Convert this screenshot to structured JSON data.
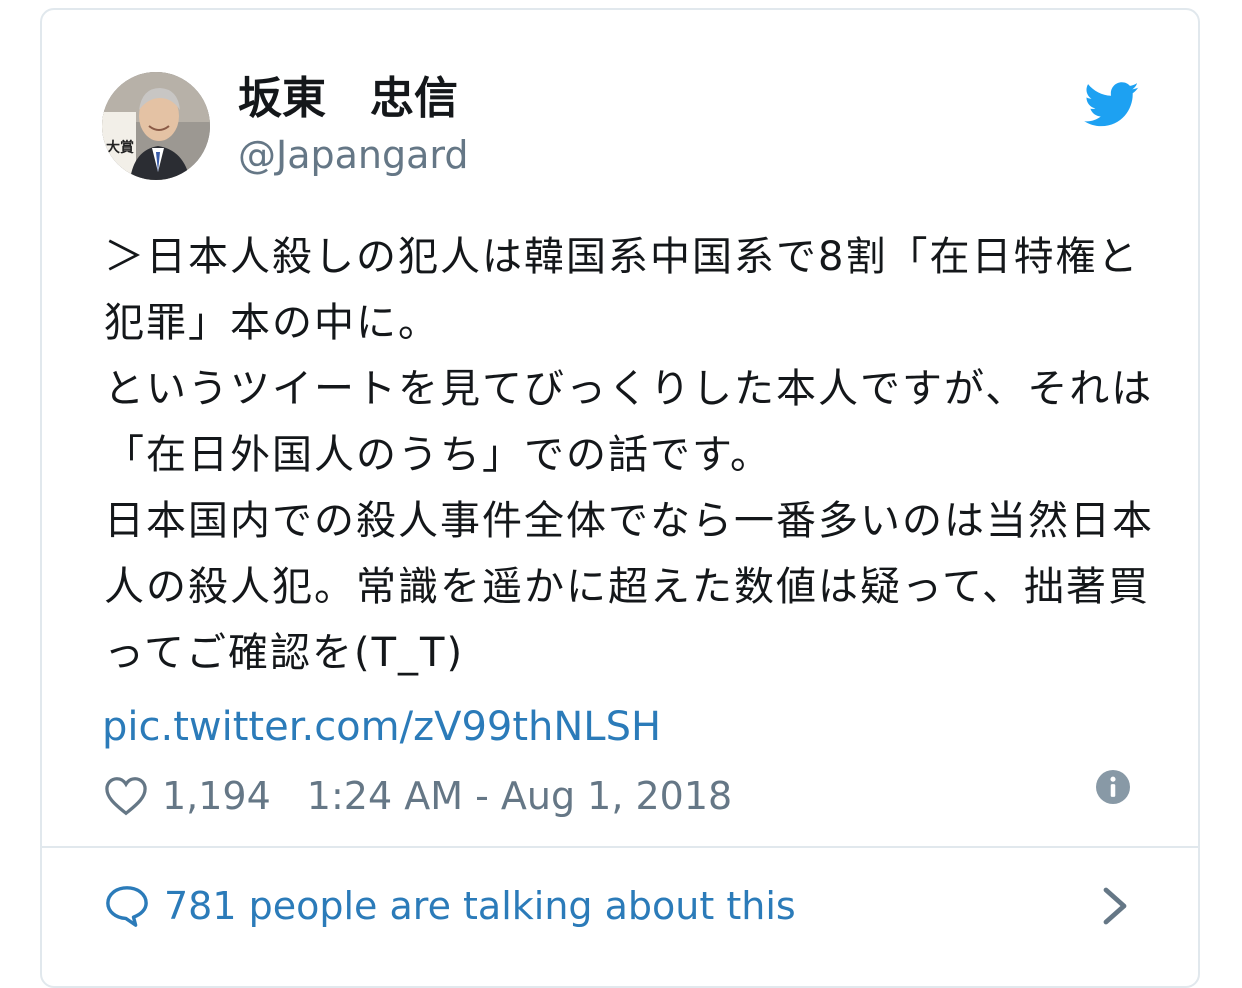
{
  "tweet": {
    "display_name": "坂東　忠信",
    "handle": "@Japangard",
    "text": "＞日本人殺しの犯人は韓国系中国系で8割「在日特権と犯罪」本の中に。\nというツイートを見てびっくりした本人ですが、それは「在日外国人のうち」での話です。\n日本国内での殺人事件全体でなら一番多いのは当然日本人の殺人犯。常識を遥かに超えた数値は疑って、拙著買ってご確認を(T_T)",
    "pic_link": "pic.twitter.com/zV99thNLSH",
    "like_count": "1,194",
    "timestamp": "1:24 AM - Aug 1, 2018",
    "conversation_label": "781 people are talking about this"
  },
  "avatar_text": "大賞",
  "icons": {
    "bird": "twitter-bird-icon",
    "heart": "heart-icon",
    "info": "info-icon",
    "bubble": "speech-bubble-icon",
    "chevron": "chevron-right-icon"
  },
  "colors": {
    "brand": "#1da1f2",
    "link": "#2b7bb9",
    "text": "#14171a",
    "muted": "#657786",
    "border": "#e1e8ed"
  }
}
